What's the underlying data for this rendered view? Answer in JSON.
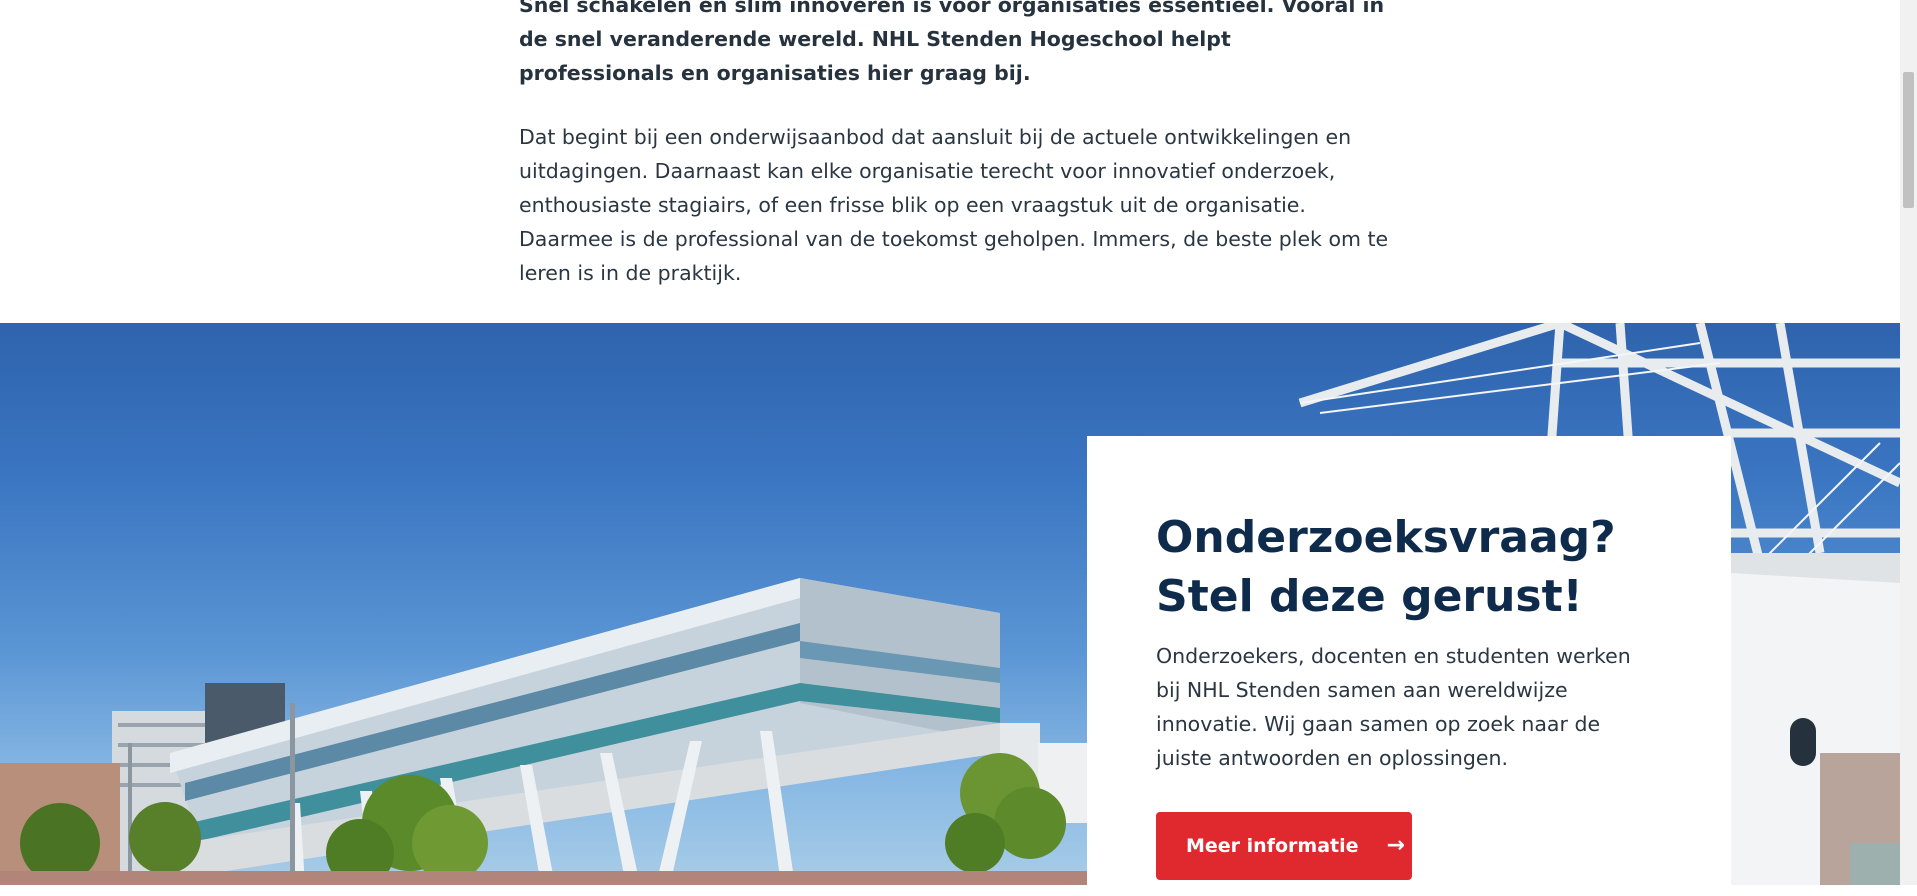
{
  "intro": {
    "lead": "Snel schakelen en slim innoveren is voor organisaties essentieel. Vooral in de snel veranderende wereld. NHL Stenden Hogeschool helpt professionals en organisaties hier graag bij.",
    "body": "Dat begint bij een onderwijsaanbod dat aansluit bij de actuele ontwikkelingen en uitdagingen. Daarnaast kan elke organisatie terecht voor innovatief onderzoek, enthousiaste stagiairs, of een frisse blik op een vraagstuk uit de organisatie. Daarmee is de professional van de toekomst geholpen. Immers, de beste plek om te leren is in de praktijk."
  },
  "card": {
    "title": "Onderzoeksvraag? Stel deze gerust!",
    "text": "Onderzoekers, docenten en studenten werken bij NHL Stenden samen aan wereldwijze innovatie. Wij gaan samen op zoek naar de juiste antwoorden en oplossingen.",
    "button_label": "Meer informatie",
    "button_icon": "arrow-right-icon"
  },
  "colors": {
    "accent": "#e0282f",
    "heading": "#0f2b4c"
  }
}
